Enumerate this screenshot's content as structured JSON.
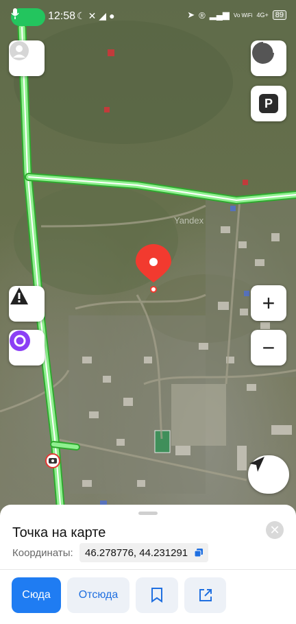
{
  "status_bar": {
    "time": "12:58",
    "icons": [
      "mic-icon",
      "moon-icon",
      "mute-icon",
      "wifi-icon",
      "location-arrow-icon",
      "registered-icon",
      "signal-icon",
      "vowifi-icon",
      "4g-icon"
    ],
    "network_label": "4G+",
    "vo_label": "Vo WiFi",
    "battery": "89"
  },
  "map": {
    "watermark": "Yandex",
    "buttons": [
      "profile-button",
      "loading-button",
      "parking-button",
      "alert-button",
      "alice-button",
      "zoom-in-button",
      "zoom-out-button",
      "locate-button"
    ],
    "parking_label": "P",
    "zoom_in_label": "+",
    "zoom_out_label": "−",
    "colors": {
      "road": "#6fe36f",
      "pin": "#f23a2f",
      "accent": "#1f7cf2"
    }
  },
  "sheet": {
    "title": "Точка на карте",
    "coordinates_label": "Координаты:",
    "coordinates_value": "46.278776, 44.231291",
    "actions": {
      "to_here": "Сюда",
      "from_here": "Отсюда"
    }
  }
}
